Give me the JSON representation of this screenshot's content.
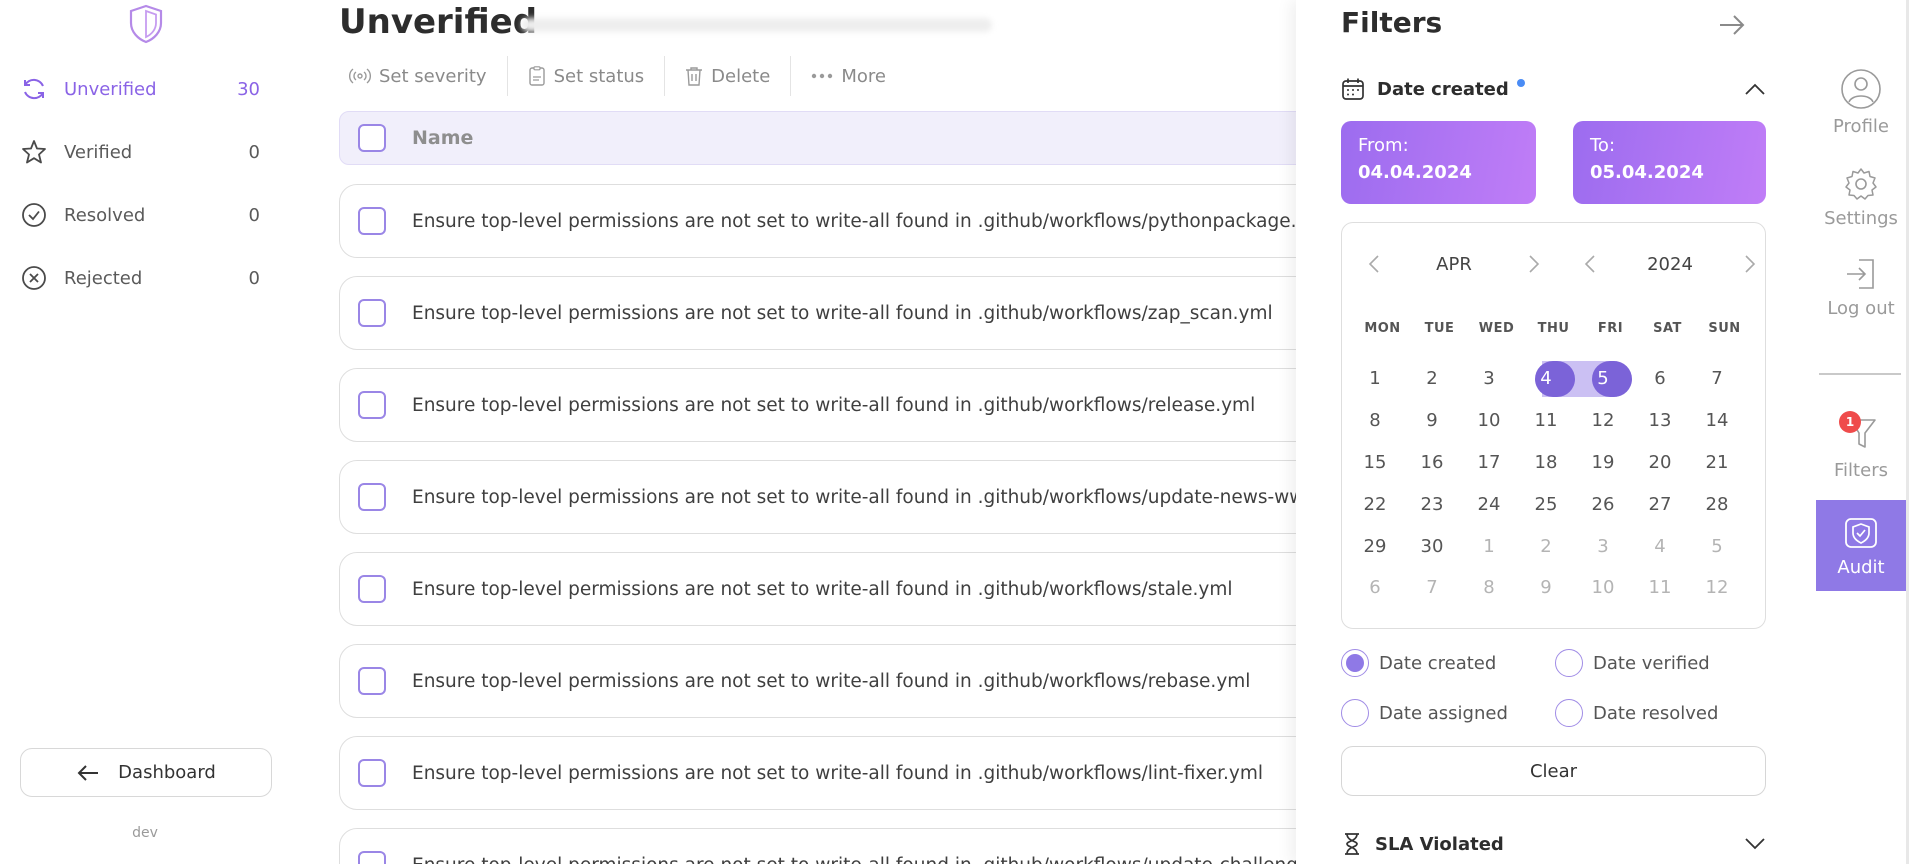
{
  "sidebar": {
    "items": [
      {
        "label": "Unverified",
        "count": "30",
        "icon": "refresh-icon"
      },
      {
        "label": "Verified",
        "count": "0",
        "icon": "star-icon"
      },
      {
        "label": "Resolved",
        "count": "0",
        "icon": "check-circle-icon"
      },
      {
        "label": "Rejected",
        "count": "0",
        "icon": "x-circle-icon"
      }
    ],
    "dashboard_label": "Dashboard",
    "env": "dev"
  },
  "main": {
    "title": "Unverified",
    "toolbar": {
      "set_severity": "Set severity",
      "set_status": "Set status",
      "delete": "Delete",
      "more": "More"
    },
    "table": {
      "header_name": "Name",
      "rows": [
        "Ensure top-level permissions are not set to write-all found in .github/workflows/pythonpackage.yml",
        "Ensure top-level permissions are not set to write-all found in .github/workflows/zap_scan.yml",
        "Ensure top-level permissions are not set to write-all found in .github/workflows/release.yml",
        "Ensure top-level permissions are not set to write-all found in .github/workflows/update-news-www.yml",
        "Ensure top-level permissions are not set to write-all found in .github/workflows/stale.yml",
        "Ensure top-level permissions are not set to write-all found in .github/workflows/rebase.yml",
        "Ensure top-level permissions are not set to write-all found in .github/workflows/lint-fixer.yml",
        "Ensure top-level permissions are not set to write-all found in .github/workflows/update-challenges.yml"
      ]
    }
  },
  "filters": {
    "title": "Filters",
    "date_created_label": "Date created",
    "from_label": "From:",
    "from_value": "04.04.2024",
    "to_label": "To:",
    "to_value": "05.04.2024",
    "calendar": {
      "month": "APR",
      "year": "2024",
      "weekdays": [
        "MON",
        "TUE",
        "WED",
        "THU",
        "FRI",
        "SAT",
        "SUN"
      ],
      "weeks": [
        [
          "1",
          "2",
          "3",
          "4",
          "5",
          "6",
          "7"
        ],
        [
          "8",
          "9",
          "10",
          "11",
          "12",
          "13",
          "14"
        ],
        [
          "15",
          "16",
          "17",
          "18",
          "19",
          "20",
          "21"
        ],
        [
          "22",
          "23",
          "24",
          "25",
          "26",
          "27",
          "28"
        ],
        [
          "29",
          "30",
          "1",
          "2",
          "3",
          "4",
          "5"
        ],
        [
          "6",
          "7",
          "8",
          "9",
          "10",
          "11",
          "12"
        ]
      ],
      "selected_range": [
        "4",
        "5"
      ]
    },
    "date_types": [
      {
        "label": "Date created",
        "checked": true
      },
      {
        "label": "Date verified",
        "checked": false
      },
      {
        "label": "Date assigned",
        "checked": false
      },
      {
        "label": "Date resolved",
        "checked": false
      }
    ],
    "clear_label": "Clear",
    "sla_label": "SLA Violated"
  },
  "rail": {
    "profile": "Profile",
    "settings": "Settings",
    "logout": "Log out",
    "filters": "Filters",
    "filters_badge": "1",
    "audit": "Audit"
  },
  "colors": {
    "accent": "#8f79e6",
    "accent_text": "#8a63e6",
    "range_fill": "#cbc0f3",
    "badge": "#ef4b4b"
  }
}
